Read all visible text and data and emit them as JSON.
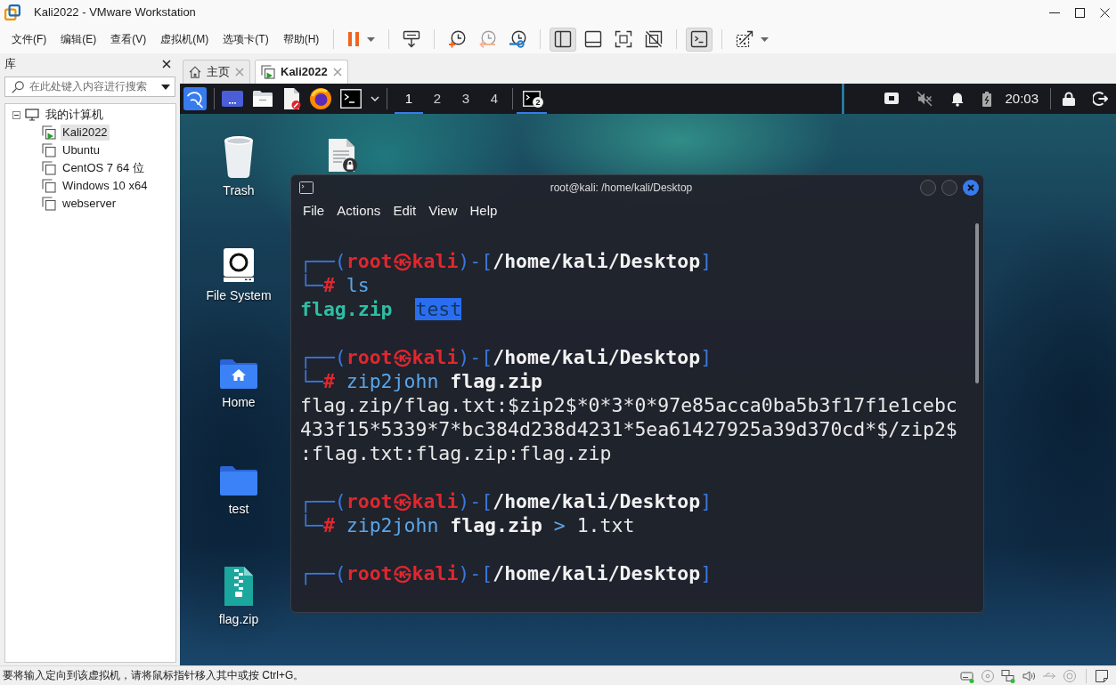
{
  "window": {
    "title": "Kali2022 - VMware Workstation"
  },
  "menu": [
    "文件(F)",
    "编辑(E)",
    "查看(V)",
    "虚拟机(M)",
    "选项卡(T)",
    "帮助(H)"
  ],
  "toolbar": [
    [
      {
        "kind": "pause",
        "pressed": false,
        "disabled": false,
        "dropdown": true
      }
    ],
    [
      {
        "kind": "send_keys",
        "pressed": false,
        "disabled": false,
        "dropdown": false
      }
    ],
    [
      {
        "kind": "snapshot_take",
        "pressed": false,
        "disabled": false,
        "dropdown": false
      },
      {
        "kind": "snapshot_revert",
        "pressed": false,
        "disabled": true,
        "dropdown": false
      },
      {
        "kind": "snapshot_manager",
        "pressed": false,
        "disabled": false,
        "dropdown": false
      }
    ],
    [
      {
        "kind": "view_library",
        "pressed": true,
        "disabled": false,
        "dropdown": false
      },
      {
        "kind": "view_thumbnail",
        "pressed": false,
        "disabled": false,
        "dropdown": false
      },
      {
        "kind": "view_fullscreen",
        "pressed": false,
        "disabled": false,
        "dropdown": false
      },
      {
        "kind": "view_unity",
        "pressed": false,
        "disabled": false,
        "dropdown": false
      }
    ],
    [
      {
        "kind": "console",
        "pressed": true,
        "disabled": false,
        "dropdown": false
      }
    ],
    [
      {
        "kind": "stretch",
        "pressed": false,
        "disabled": false,
        "dropdown": true
      }
    ]
  ],
  "library": {
    "title": "库",
    "search": {
      "placeholder": "在此处键入内容进行搜索"
    },
    "tree": [
      {
        "label": "我的计算机",
        "expanded": true,
        "selected": false,
        "children": [
          {
            "label": "Kali2022",
            "running": true,
            "selected": true
          },
          {
            "label": "Ubuntu",
            "running": false,
            "selected": false
          },
          {
            "label": "CentOS 7 64 位",
            "running": false,
            "selected": false
          },
          {
            "label": "Windows 10 x64",
            "running": false,
            "selected": false
          },
          {
            "label": "webserver",
            "running": false,
            "selected": false
          }
        ]
      }
    ]
  },
  "tabs": [
    {
      "label": "主页",
      "kind": "home",
      "selected": false
    },
    {
      "label": "Kali2022",
      "kind": "vm",
      "selected": true
    }
  ],
  "guest": {
    "panel": {
      "launchers": [
        {
          "kind": "app_menu"
        },
        {
          "kind": "desktop"
        },
        {
          "kind": "files"
        },
        {
          "kind": "editor"
        },
        {
          "kind": "browser"
        },
        {
          "kind": "terminal"
        },
        {
          "kind": "expand"
        }
      ],
      "workspaces": [
        {
          "label": "1",
          "selected": true
        },
        {
          "label": "2",
          "selected": false
        },
        {
          "label": "3",
          "selected": false
        },
        {
          "label": "4",
          "selected": false
        }
      ],
      "tasks": [
        {
          "kind": "terminal",
          "badge": "2",
          "active": true
        }
      ],
      "tray": [
        {
          "kind": "load_graph"
        },
        {
          "kind": "network"
        },
        {
          "kind": "volume_muted"
        },
        {
          "kind": "notifications"
        },
        {
          "kind": "battery"
        }
      ],
      "clock": "20:03",
      "session": [
        {
          "kind": "lock"
        },
        {
          "kind": "logout"
        }
      ]
    },
    "desktop_icons": [
      {
        "label": "Trash",
        "kind": "trash"
      },
      {
        "label": "File System",
        "kind": "drive"
      },
      {
        "label": "Home",
        "kind": "home_folder"
      },
      {
        "label": "test",
        "kind": "folder"
      },
      {
        "label": "flag.zip",
        "kind": "archive"
      },
      {
        "kind": "locked_file"
      }
    ],
    "terminal": {
      "title": "root@kali: /home/kali/Desktop",
      "menu": [
        "File",
        "Actions",
        "Edit",
        "View",
        "Help"
      ],
      "blocks": [
        {
          "lines": [
            [
              {
                "kind": "frame",
                "text": "┌──("
              },
              {
                "kind": "user",
                "text": "root㉿kali"
              },
              {
                "kind": "frame",
                "text": ")-["
              },
              {
                "kind": "path",
                "text": "/home/kali/Desktop"
              },
              {
                "kind": "frame",
                "text": "]"
              }
            ],
            [
              {
                "kind": "frame",
                "text": "└─"
              },
              {
                "kind": "hash",
                "text": "# "
              },
              {
                "kind": "cmd",
                "text": "ls"
              }
            ],
            [
              {
                "kind": "archive",
                "text": "flag.zip  "
              },
              {
                "kind": "dir",
                "text": "test"
              }
            ]
          ]
        },
        {
          "lines": [
            [
              {
                "kind": "frame",
                "text": "┌──("
              },
              {
                "kind": "user",
                "text": "root㉿kali"
              },
              {
                "kind": "frame",
                "text": ")-["
              },
              {
                "kind": "path",
                "text": "/home/kali/Desktop"
              },
              {
                "kind": "frame",
                "text": "]"
              }
            ],
            [
              {
                "kind": "frame",
                "text": "└─"
              },
              {
                "kind": "hash",
                "text": "# "
              },
              {
                "kind": "cmd",
                "text": "zip2john "
              },
              {
                "kind": "arg",
                "text": "flag.zip"
              }
            ],
            [
              {
                "kind": "plain",
                "text": "flag.zip/flag.txt:$zip2$*0*3*0*97e85acca0ba5b3f17f1e1cebc"
              }
            ],
            [
              {
                "kind": "plain",
                "text": "433f15*5339*7*bc384d238d4231*5ea61427925a39d370cd*$/zip2$"
              }
            ],
            [
              {
                "kind": "plain",
                "text": ":flag.txt:flag.zip:flag.zip"
              }
            ]
          ]
        },
        {
          "lines": [
            [
              {
                "kind": "frame",
                "text": "┌──("
              },
              {
                "kind": "user",
                "text": "root㉿kali"
              },
              {
                "kind": "frame",
                "text": ")-["
              },
              {
                "kind": "path",
                "text": "/home/kali/Desktop"
              },
              {
                "kind": "frame",
                "text": "]"
              }
            ],
            [
              {
                "kind": "frame",
                "text": "└─"
              },
              {
                "kind": "hash",
                "text": "# "
              },
              {
                "kind": "cmd",
                "text": "zip2john "
              },
              {
                "kind": "arg",
                "text": "flag.zip "
              },
              {
                "kind": "cmd",
                "text": "> "
              },
              {
                "kind": "plain",
                "text": "1.txt"
              }
            ]
          ]
        },
        {
          "lines": [
            [
              {
                "kind": "frame",
                "text": "┌──("
              },
              {
                "kind": "user",
                "text": "root㉿kali"
              },
              {
                "kind": "frame",
                "text": ")-["
              },
              {
                "kind": "path",
                "text": "/home/kali/Desktop"
              },
              {
                "kind": "frame",
                "text": "]"
              }
            ]
          ]
        }
      ]
    }
  },
  "status_bar": {
    "message": "要将输入定向到该虚拟机，请将鼠标指针移入其中或按 Ctrl+G。",
    "devices": [
      {
        "kind": "hard_disk",
        "active": true
      },
      {
        "kind": "cd",
        "active": false
      },
      {
        "kind": "network",
        "active": true
      },
      {
        "kind": "sound",
        "active": false
      },
      {
        "kind": "usb",
        "active": false
      },
      {
        "kind": "display",
        "active": false
      }
    ]
  }
}
